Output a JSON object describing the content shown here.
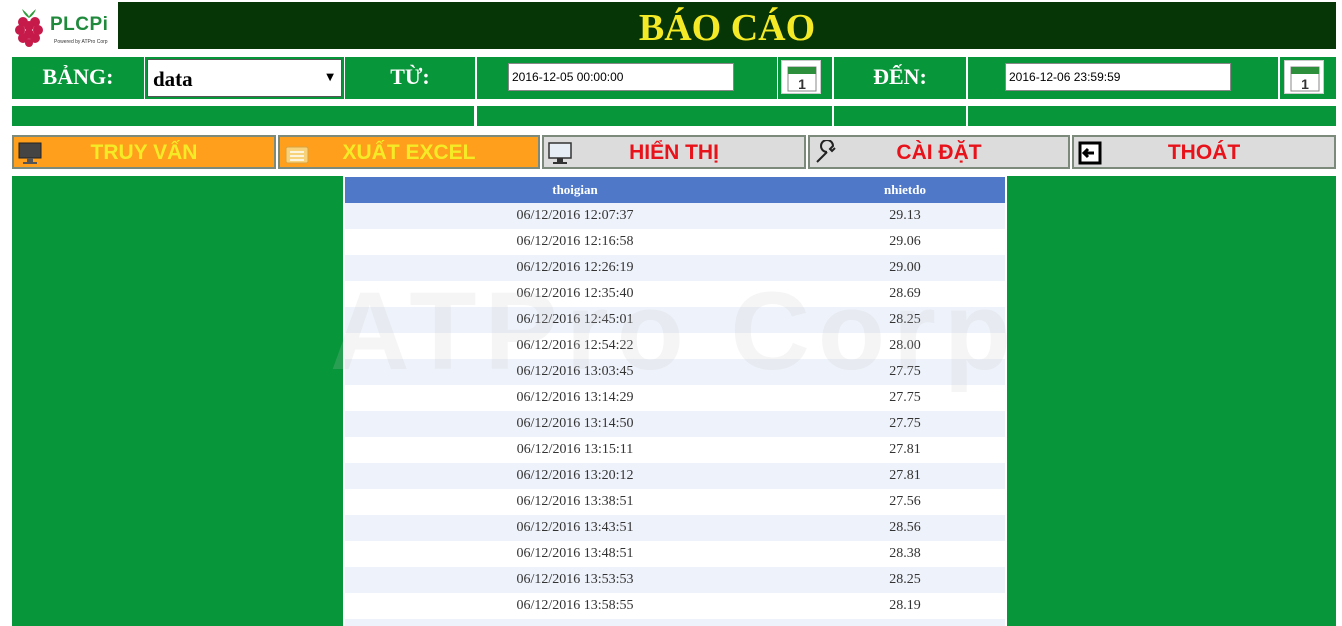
{
  "header": {
    "logo_text": "PLCPi",
    "logo_subtitle": "Powered by ATPro Corp",
    "title": "BÁO CÁO"
  },
  "filter": {
    "table_label": "BẢNG:",
    "table_value": "data",
    "from_label": "TỪ:",
    "from_value": "2016-12-05 00:00:00",
    "to_label": "ĐẾN:",
    "to_value": "2016-12-06 23:59:59"
  },
  "toolbar": {
    "query_label": "TRUY VẤN",
    "export_label": "XUẤT EXCEL",
    "display_label": "HIỂN THỊ",
    "settings_label": "CÀI ĐẶT",
    "exit_label": "THOÁT"
  },
  "table": {
    "columns": [
      "thoigian",
      "nhietdo"
    ],
    "rows": [
      [
        "06/12/2016 12:07:37",
        "29.13"
      ],
      [
        "06/12/2016 12:16:58",
        "29.06"
      ],
      [
        "06/12/2016 12:26:19",
        "29.00"
      ],
      [
        "06/12/2016 12:35:40",
        "28.69"
      ],
      [
        "06/12/2016 12:45:01",
        "28.25"
      ],
      [
        "06/12/2016 12:54:22",
        "28.00"
      ],
      [
        "06/12/2016 13:03:45",
        "27.75"
      ],
      [
        "06/12/2016 13:14:29",
        "27.75"
      ],
      [
        "06/12/2016 13:14:50",
        "27.75"
      ],
      [
        "06/12/2016 13:15:11",
        "27.81"
      ],
      [
        "06/12/2016 13:20:12",
        "27.81"
      ],
      [
        "06/12/2016 13:38:51",
        "27.56"
      ],
      [
        "06/12/2016 13:43:51",
        "28.56"
      ],
      [
        "06/12/2016 13:48:51",
        "28.38"
      ],
      [
        "06/12/2016 13:53:53",
        "28.25"
      ],
      [
        "06/12/2016 13:58:55",
        "28.19"
      ],
      [
        "",
        ""
      ]
    ]
  },
  "watermark": "ATPro Corp",
  "colors": {
    "green": "#07963a",
    "dark_green": "#063506",
    "title_yellow": "#f5ea26",
    "orange": "#ff9f1c",
    "button_gray": "#dcdcdc",
    "button_red_text": "#e8121b",
    "table_header": "#4f78c9"
  },
  "icons": {
    "logo": "raspberry-logo-icon",
    "calendar": "calendar-icon",
    "query": "monitor-icon",
    "export": "spreadsheet-icon",
    "display": "desktop-icon",
    "settings": "wrench-icon",
    "exit": "exit-icon"
  }
}
